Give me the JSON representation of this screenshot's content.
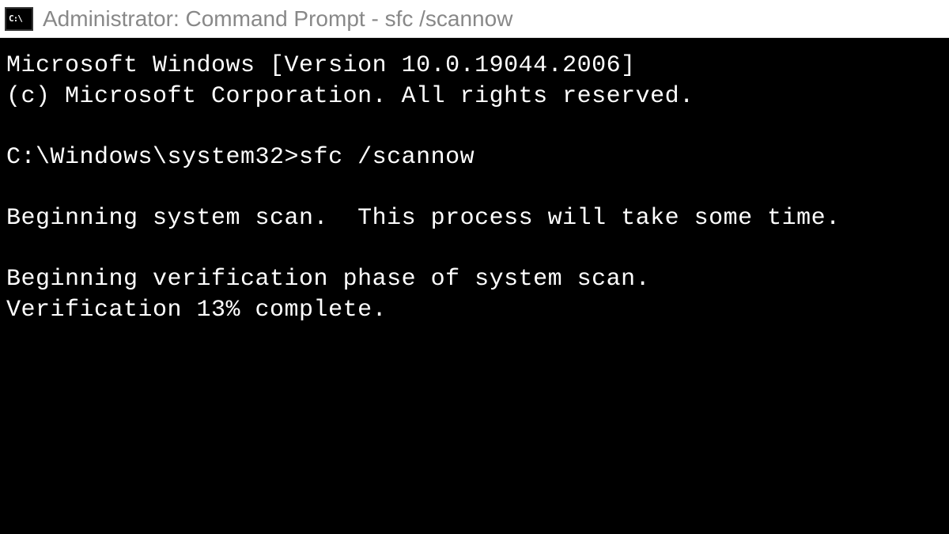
{
  "titleBar": {
    "iconText": "C:\\",
    "title": "Administrator: Command Prompt - sfc /scannow"
  },
  "terminal": {
    "lines": [
      "Microsoft Windows [Version 10.0.19044.2006]",
      "(c) Microsoft Corporation. All rights reserved.",
      "",
      "C:\\Windows\\system32>sfc /scannow",
      "",
      "Beginning system scan.  This process will take some time.",
      "",
      "Beginning verification phase of system scan.",
      "Verification 13% complete."
    ]
  }
}
